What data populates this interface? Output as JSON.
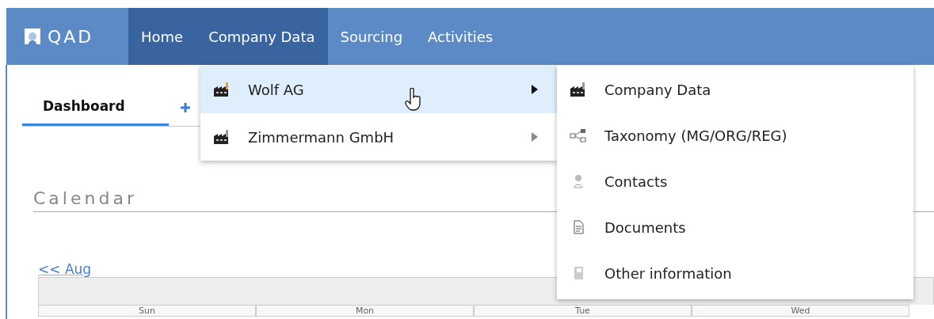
{
  "brand": {
    "name": "QAD"
  },
  "nav": [
    {
      "label": "Home",
      "highlighted": true
    },
    {
      "label": "Company Data",
      "highlighted": true
    },
    {
      "label": "Sourcing",
      "highlighted": false
    },
    {
      "label": "Activities",
      "highlighted": false
    }
  ],
  "tabs": [
    {
      "label": "Dashboard",
      "selected": true
    }
  ],
  "calendar": {
    "title": "Calendar",
    "prev_link": "<< Aug",
    "days": [
      "Sun",
      "Mon",
      "Tue",
      "Wed"
    ]
  },
  "menu": [
    {
      "label": "Wolf AG",
      "highlighted": true,
      "has_submenu": true
    },
    {
      "label": "Zimmermann GmbH",
      "highlighted": false,
      "has_submenu": true
    }
  ],
  "submenu": [
    {
      "kind": "factory",
      "label": "Company Data"
    },
    {
      "kind": "taxonomy",
      "label": "Taxonomy (MG/ORG/REG)"
    },
    {
      "kind": "contact",
      "label": "Contacts"
    },
    {
      "kind": "document",
      "label": "Documents"
    },
    {
      "kind": "info",
      "label": "Other information"
    }
  ]
}
